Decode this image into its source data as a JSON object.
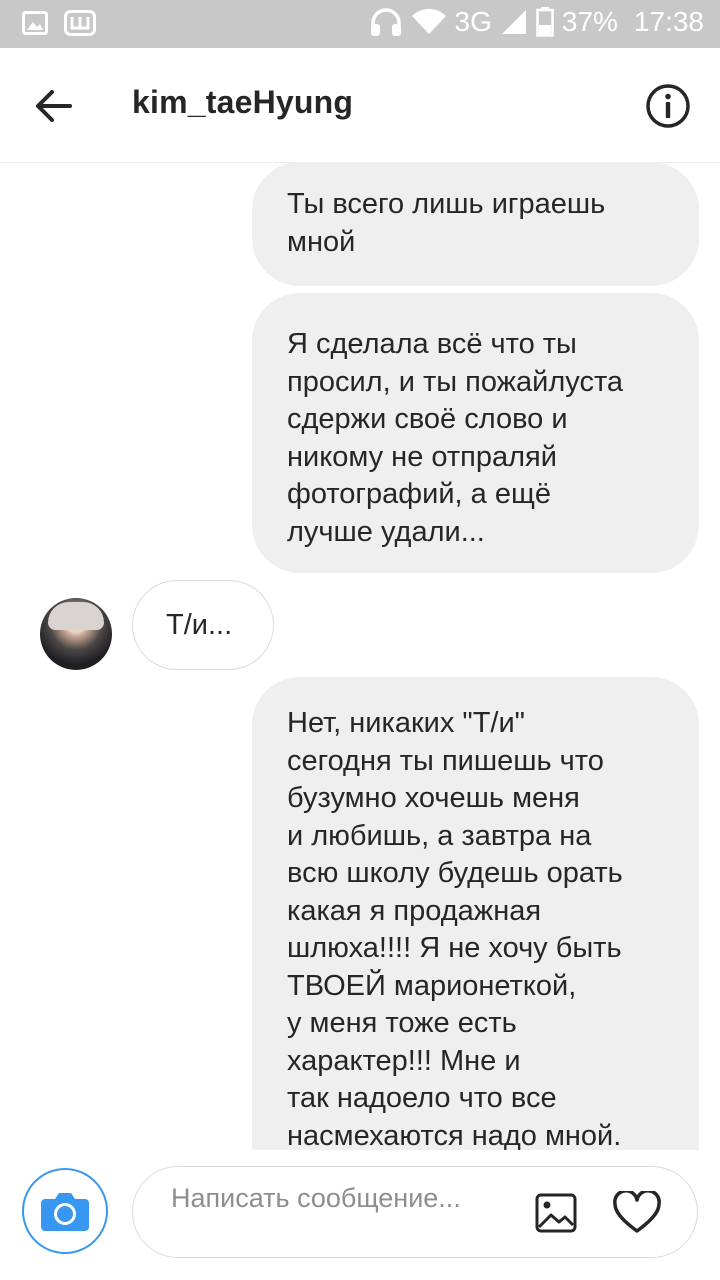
{
  "status_bar": {
    "network": "3G",
    "battery": "37%",
    "time": "17:38",
    "icons": [
      "image-icon",
      "app-w-icon",
      "headphones-icon",
      "wifi-icon",
      "signal-icon",
      "battery-icon"
    ]
  },
  "header": {
    "username": "kim_taeHyung",
    "back_icon": "arrow-left-icon",
    "info_icon": "info-circle-icon"
  },
  "messages": [
    {
      "direction": "outgoing",
      "text": "Ты всего лишь играешь\nмной"
    },
    {
      "direction": "outgoing",
      "text": "Я сделала всё что ты\nпросил, и ты пожайлуста\nсдержи своё слово и\nникому не отпраляй\nфотографий, а ещё\nлучше удали..."
    },
    {
      "direction": "incoming",
      "text": "Т/и..."
    },
    {
      "direction": "outgoing",
      "text": "Нет, никаких \"Т/и\"\nсегодня ты пишешь что\nбузумно хочешь меня\nи любишь, а завтра на\nвсю школу будешь орать\nкакая я продажная\nшлюха!!!! Я не хочу быть\nТВОЕЙ марионеткой,\nу меня тоже есть\nхарактер!!! Мне и\nтак надоело что все\nнасмехаются надо мной."
    }
  ],
  "composer": {
    "placeholder": "Написать сообщение...",
    "value": "",
    "camera_icon": "camera-icon",
    "gallery_icon": "gallery-icon",
    "heart_icon": "heart-icon"
  },
  "colors": {
    "accent": "#3897f0",
    "bubble_outgoing": "#efefef",
    "status_bar": "#c8c8c8",
    "text": "#262626",
    "placeholder": "#8e8e8e"
  }
}
